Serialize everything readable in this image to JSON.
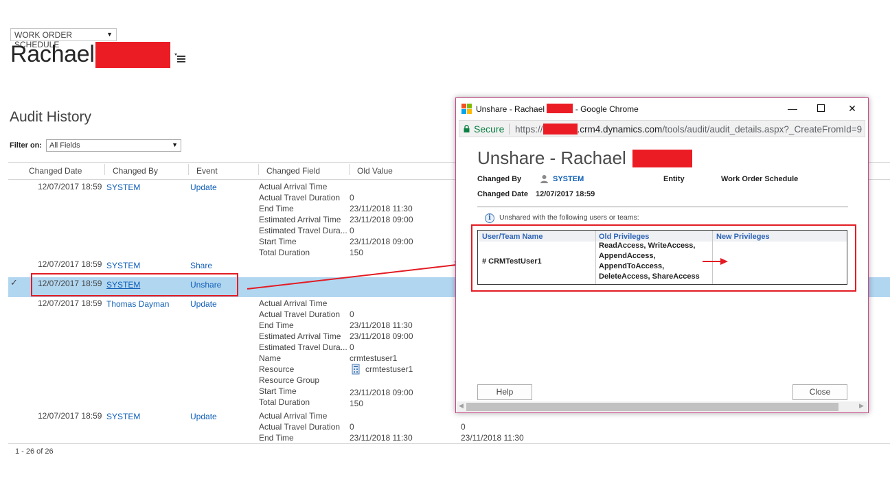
{
  "header": {
    "entity_selector": "WORK ORDER SCHEDULE",
    "record_name": "Rachael"
  },
  "audit": {
    "title": "Audit History",
    "filter_label": "Filter on:",
    "filter_value": "All Fields",
    "columns": [
      "Changed Date",
      "Changed By",
      "Event",
      "Changed Field",
      "Old Value"
    ],
    "rows": [
      {
        "date": "12/07/2017 18:59",
        "by": "SYSTEM",
        "event": "Update",
        "fields": [
          "Actual Arrival Time",
          "Actual Travel Duration",
          "End Time",
          "Estimated Arrival Time",
          "Estimated Travel Dura...",
          "Start Time",
          "Total Duration"
        ],
        "old": [
          "",
          "0",
          "23/11/2018 11:30",
          "23/11/2018 09:00",
          "0",
          "23/11/2018 09:00",
          "150"
        ]
      },
      {
        "date": "12/07/2017 18:59",
        "by": "SYSTEM",
        "event": "Share"
      },
      {
        "date": "12/07/2017 18:59",
        "by": "SYSTEM",
        "event": "Unshare",
        "selected": true
      },
      {
        "date": "12/07/2017 18:59",
        "by": "Thomas Dayman",
        "event": "Update",
        "fields": [
          "Actual Arrival Time",
          "Actual Travel Duration",
          "End Time",
          "Estimated Arrival Time",
          "Estimated Travel Dura...",
          "Name",
          "Resource",
          "Resource Group",
          "Start Time",
          "Total Duration"
        ],
        "old": [
          "",
          "0",
          "23/11/2018 11:30",
          "23/11/2018 09:00",
          "0",
          "crmtestuser1",
          "crmtestuser1",
          "",
          "23/11/2018 09:00",
          "150"
        ]
      },
      {
        "date": "12/07/2017 18:59",
        "by": "SYSTEM",
        "event": "Update",
        "fields": [
          "Actual Arrival Time",
          "Actual Travel Duration",
          "End Time"
        ],
        "old": [
          "",
          "0",
          "23/11/2018 11:30"
        ],
        "new": [
          "",
          "0",
          "23/11/2018 11:30"
        ]
      }
    ],
    "paging": "1 - 26 of 26"
  },
  "popup": {
    "window_title_prefix": "Unshare - Rachael",
    "window_title_suffix": "- Google Chrome",
    "secure_label": "Secure",
    "url_scheme": "https://",
    "url_rest": ".crm4.dynamics.com",
    "url_path": "/tools/audit/audit_details.aspx?_CreateFromId=9",
    "dialog_title": "Unshare - Rachael",
    "changed_by_label": "Changed By",
    "changed_by_value": "SYSTEM",
    "entity_label": "Entity",
    "entity_value": "Work Order Schedule",
    "changed_date_label": "Changed Date",
    "changed_date_value": "12/07/2017 18:59",
    "info_text": "Unshared with the following users or teams:",
    "table_headers": [
      "User/Team Name",
      "Old Privileges",
      "New Privileges"
    ],
    "table_row": {
      "user": "# CRMTestUser1",
      "old_privileges": [
        "ReadAccess, WriteAccess,",
        "AppendAccess,",
        "AppendToAccess,",
        "DeleteAccess, ShareAccess"
      ],
      "new_privileges": ""
    },
    "help_button": "Help",
    "close_button": "Close"
  },
  "colors": {
    "link": "#1160b7",
    "selected_row": "#b1d6f0",
    "redaction": "#ec1c24",
    "callout": "#e31b23"
  }
}
